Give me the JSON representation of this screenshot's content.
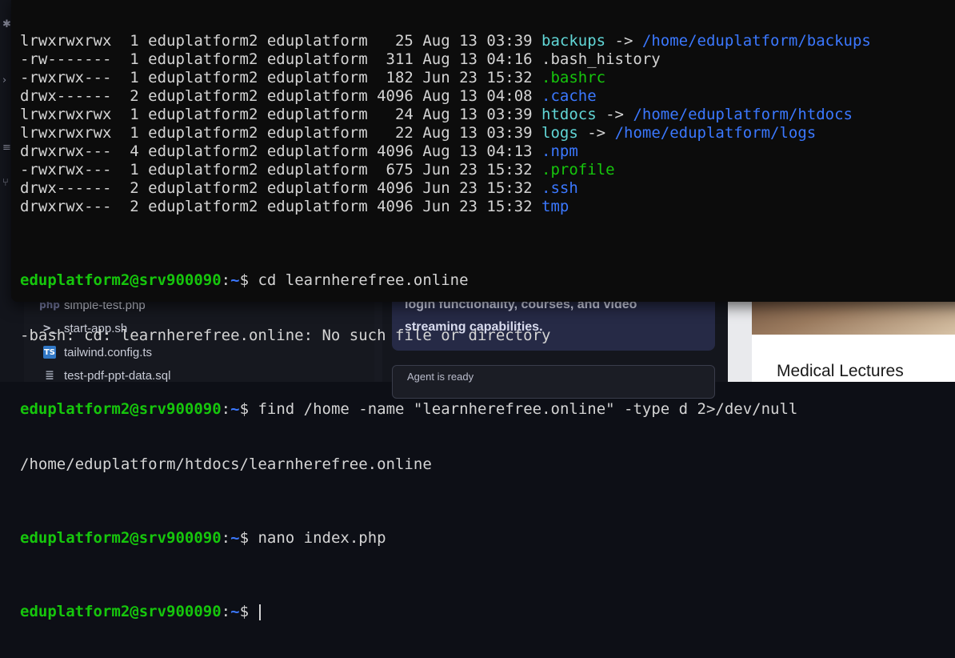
{
  "terminal": {
    "listing": [
      {
        "perms": "lrwxrwxrwx",
        "links": "1",
        "owner": "eduplatform2",
        "group": "eduplatform",
        "size": "25",
        "month": "Aug",
        "day": "13",
        "time": "03:39",
        "name": "backups",
        "arrow": " -> ",
        "target": "/home/eduplatform/backups",
        "kind": "link"
      },
      {
        "perms": "-rw-------",
        "links": "1",
        "owner": "eduplatform2",
        "group": "eduplatform",
        "size": "311",
        "month": "Aug",
        "day": "13",
        "time": "04:16",
        "name": ".bash_history",
        "arrow": "",
        "target": "",
        "kind": "file"
      },
      {
        "perms": "-rwxrwx---",
        "links": "1",
        "owner": "eduplatform2",
        "group": "eduplatform",
        "size": "182",
        "month": "Jun",
        "day": "23",
        "time": "15:32",
        "name": ".bashrc",
        "arrow": "",
        "target": "",
        "kind": "exec"
      },
      {
        "perms": "drwx------",
        "links": "2",
        "owner": "eduplatform2",
        "group": "eduplatform",
        "size": "4096",
        "month": "Aug",
        "day": "13",
        "time": "04:08",
        "name": ".cache",
        "arrow": "",
        "target": "",
        "kind": "dir"
      },
      {
        "perms": "lrwxrwxrwx",
        "links": "1",
        "owner": "eduplatform2",
        "group": "eduplatform",
        "size": "24",
        "month": "Aug",
        "day": "13",
        "time": "03:39",
        "name": "htdocs",
        "arrow": " -> ",
        "target": "/home/eduplatform/htdocs",
        "kind": "link"
      },
      {
        "perms": "lrwxrwxrwx",
        "links": "1",
        "owner": "eduplatform2",
        "group": "eduplatform",
        "size": "22",
        "month": "Aug",
        "day": "13",
        "time": "03:39",
        "name": "logs",
        "arrow": " -> ",
        "target": "/home/eduplatform/logs",
        "kind": "link"
      },
      {
        "perms": "drwxrwx---",
        "links": "4",
        "owner": "eduplatform2",
        "group": "eduplatform",
        "size": "4096",
        "month": "Aug",
        "day": "13",
        "time": "04:13",
        "name": ".npm",
        "arrow": "",
        "target": "",
        "kind": "dir"
      },
      {
        "perms": "-rwxrwx---",
        "links": "1",
        "owner": "eduplatform2",
        "group": "eduplatform",
        "size": "675",
        "month": "Jun",
        "day": "23",
        "time": "15:32",
        "name": ".profile",
        "arrow": "",
        "target": "",
        "kind": "exec"
      },
      {
        "perms": "drwx------",
        "links": "2",
        "owner": "eduplatform2",
        "group": "eduplatform",
        "size": "4096",
        "month": "Jun",
        "day": "23",
        "time": "15:32",
        "name": ".ssh",
        "arrow": "",
        "target": "",
        "kind": "dir"
      },
      {
        "perms": "drwxrwx---",
        "links": "2",
        "owner": "eduplatform2",
        "group": "eduplatform",
        "size": "4096",
        "month": "Jun",
        "day": "23",
        "time": "15:32",
        "name": "tmp",
        "arrow": "",
        "target": "",
        "kind": "dir"
      }
    ],
    "prompt_user": "eduplatform2@srv900090",
    "prompt_sep": ":",
    "prompt_path": "~",
    "prompt_sign": "$ ",
    "cmd1": "cd learnherefree.online",
    "err1": "-bash: cd: learnherefree.online: No such file or directory",
    "cmd2": "find /home -name \"learnherefree.online\" -type d 2>/dev/null",
    "out2": "/home/eduplatform/htdocs/learnherefree.online",
    "cmd3": "nano index.php",
    "cmd4": ""
  },
  "explorer": {
    "files": [
      {
        "name": "simple-test.php",
        "icon": "php-icon"
      },
      {
        "name": "start-app.sh",
        "icon": "terminal-icon"
      },
      {
        "name": "tailwind.config.ts",
        "icon": "typescript-icon"
      },
      {
        "name": "test-pdf-ppt-data.sql",
        "icon": "database-icon"
      }
    ]
  },
  "chat": {
    "message_tail": "login functionality, courses, and video streaming capabilities.",
    "agent_status": "Agent is ready"
  },
  "preview": {
    "card_title": "Medical Lectures"
  },
  "colors": {
    "terminal_bg": "#0c0c0c",
    "prompt_green": "#16c60c",
    "path_blue": "#3b78ff",
    "dir_blue": "#3b78ff",
    "link_cyan": "#61d6d6",
    "exec_green": "#16c60c"
  }
}
